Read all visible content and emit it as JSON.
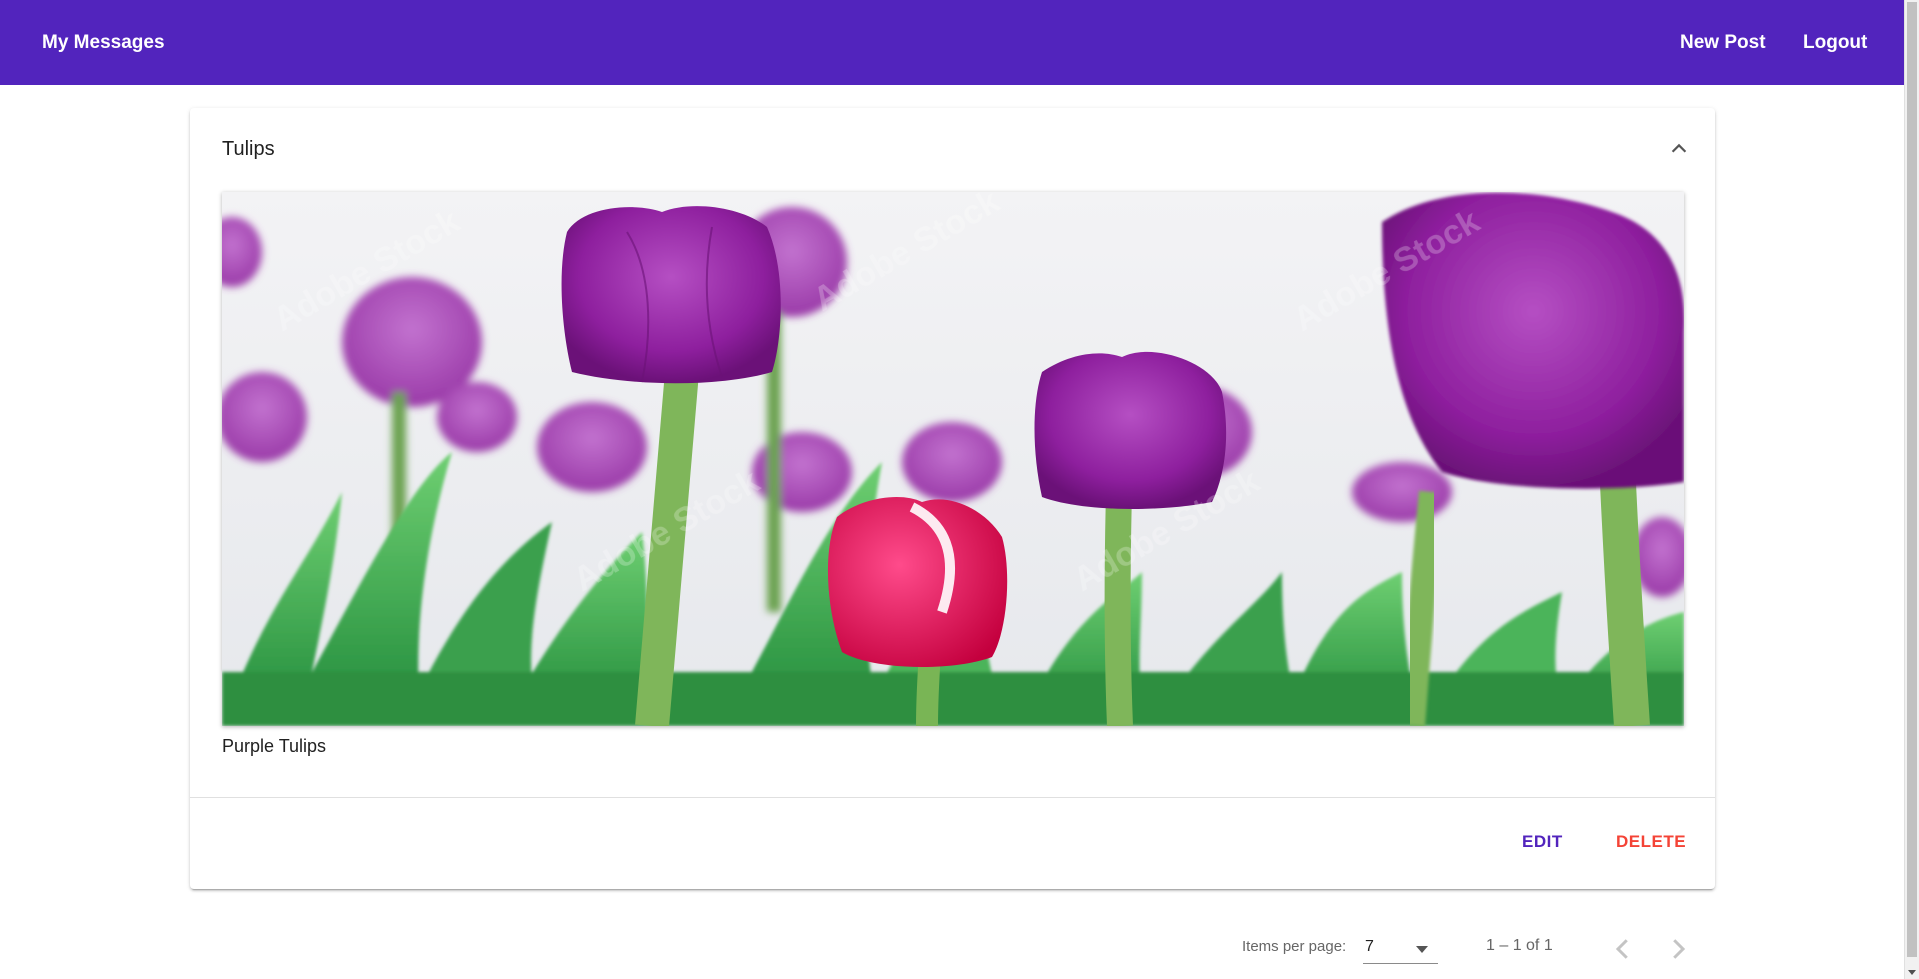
{
  "toolbar": {
    "brand": "My Messages",
    "new_post": "New Post",
    "logout": "Logout"
  },
  "post": {
    "title": "Tulips",
    "caption": "Purple Tulips",
    "edit_label": "EDIT",
    "delete_label": "DELETE",
    "image_watermark": "Adobe Stock"
  },
  "paginator": {
    "items_per_page_label": "Items per page:",
    "items_per_page_value": "7",
    "range_label": "1 – 1 of 1"
  },
  "colors": {
    "primary": "#5224bd",
    "warn": "#f44336"
  },
  "icons": {
    "collapse": "chevron-up-icon",
    "prev": "chevron-left-icon",
    "next": "chevron-right-icon",
    "select": "caret-down-icon"
  }
}
